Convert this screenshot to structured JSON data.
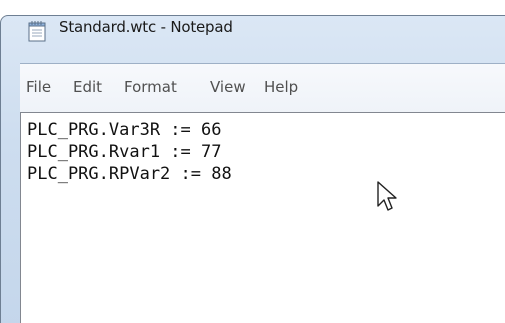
{
  "window": {
    "title": "Standard.wtc - Notepad",
    "app_icon": "notepad-icon"
  },
  "menu": {
    "items": [
      {
        "label": "File"
      },
      {
        "label": "Edit"
      },
      {
        "label": "Format"
      },
      {
        "label": "View"
      },
      {
        "label": "Help"
      }
    ]
  },
  "editor": {
    "lines": [
      "PLC_PRG.Var3R := 66",
      "PLC_PRG.Rvar1 := 77",
      "PLC_PRG.RPVar2 := 88"
    ]
  },
  "cursor": {
    "icon": "arrow-cursor-icon"
  }
}
